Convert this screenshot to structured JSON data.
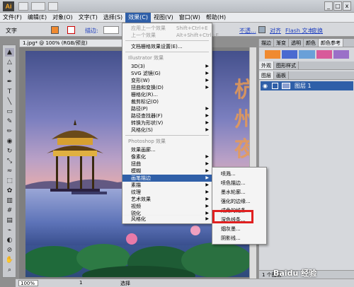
{
  "app": {
    "logo": "Ai"
  },
  "window_controls": [
    "_",
    "□",
    "x"
  ],
  "menubar": [
    "文件(F)",
    "编辑(E)",
    "对象(O)",
    "文字(T)",
    "选择(S)",
    "效果(C)",
    "视图(V)",
    "窗口(W)",
    "帮助(H)"
  ],
  "control_bar": {
    "label": "文字",
    "stroke_label": "描边:",
    "right_links": [
      "不透...",
      "对齐",
      "Flash 文本",
      "变换"
    ]
  },
  "document": {
    "tab_title": "1.jpg* @ 100% (RGB/预览)"
  },
  "canvas_text": [
    "杭",
    "州",
    "夜"
  ],
  "effect_menu": {
    "items": [
      {
        "label": "应用上一个效果",
        "shortcut": "Shift+Ctrl+E",
        "disabled": true
      },
      {
        "label": "上一个效果",
        "shortcut": "Alt+Shift+Ctrl+E",
        "disabled": true
      },
      {
        "label": "文档栅格效果设置(E)..."
      },
      {
        "section": "Illustrator 效果"
      },
      {
        "label": "3D(3)"
      },
      {
        "label": "SVG 滤镜(G)"
      },
      {
        "label": "变形(W)"
      },
      {
        "label": "扭曲和变换(D)"
      },
      {
        "label": "栅格化(R)..."
      },
      {
        "label": "裁剪标记(O)"
      },
      {
        "label": "路径(P)"
      },
      {
        "label": "路径查找器(F)"
      },
      {
        "label": "转换为形状(V)"
      },
      {
        "label": "风格化(S)"
      },
      {
        "section": "Photoshop 效果"
      },
      {
        "label": "效果画廊..."
      },
      {
        "label": "像素化"
      },
      {
        "label": "扭曲"
      },
      {
        "label": "模糊"
      },
      {
        "label": "画笔描边",
        "highlighted": true
      },
      {
        "label": "素描"
      },
      {
        "label": "纹理"
      },
      {
        "label": "艺术效果"
      },
      {
        "label": "视频"
      },
      {
        "label": "锐化"
      },
      {
        "label": "风格化"
      }
    ]
  },
  "brush_submenu": {
    "items": [
      "喷溅...",
      "喷色描边...",
      "墨水轮廓...",
      "强化的边缘...",
      "成角的线条...",
      "深色线条...",
      "烟灰墨...",
      "阴影线..."
    ],
    "selected_index": 5
  },
  "panel": {
    "tabs_top": [
      "描边",
      "渐变",
      "透明",
      "颜色",
      "颜色参考"
    ],
    "tabs_mid": [
      "外观",
      "图形样式"
    ],
    "tabs_layers": [
      "图层",
      "画板"
    ],
    "layer_name": "图层 1",
    "layer_count": "1 个图层"
  },
  "statusbar": {
    "zoom": "100%",
    "page": "1",
    "tool": "选择"
  },
  "watermark": "Baidu 经验"
}
